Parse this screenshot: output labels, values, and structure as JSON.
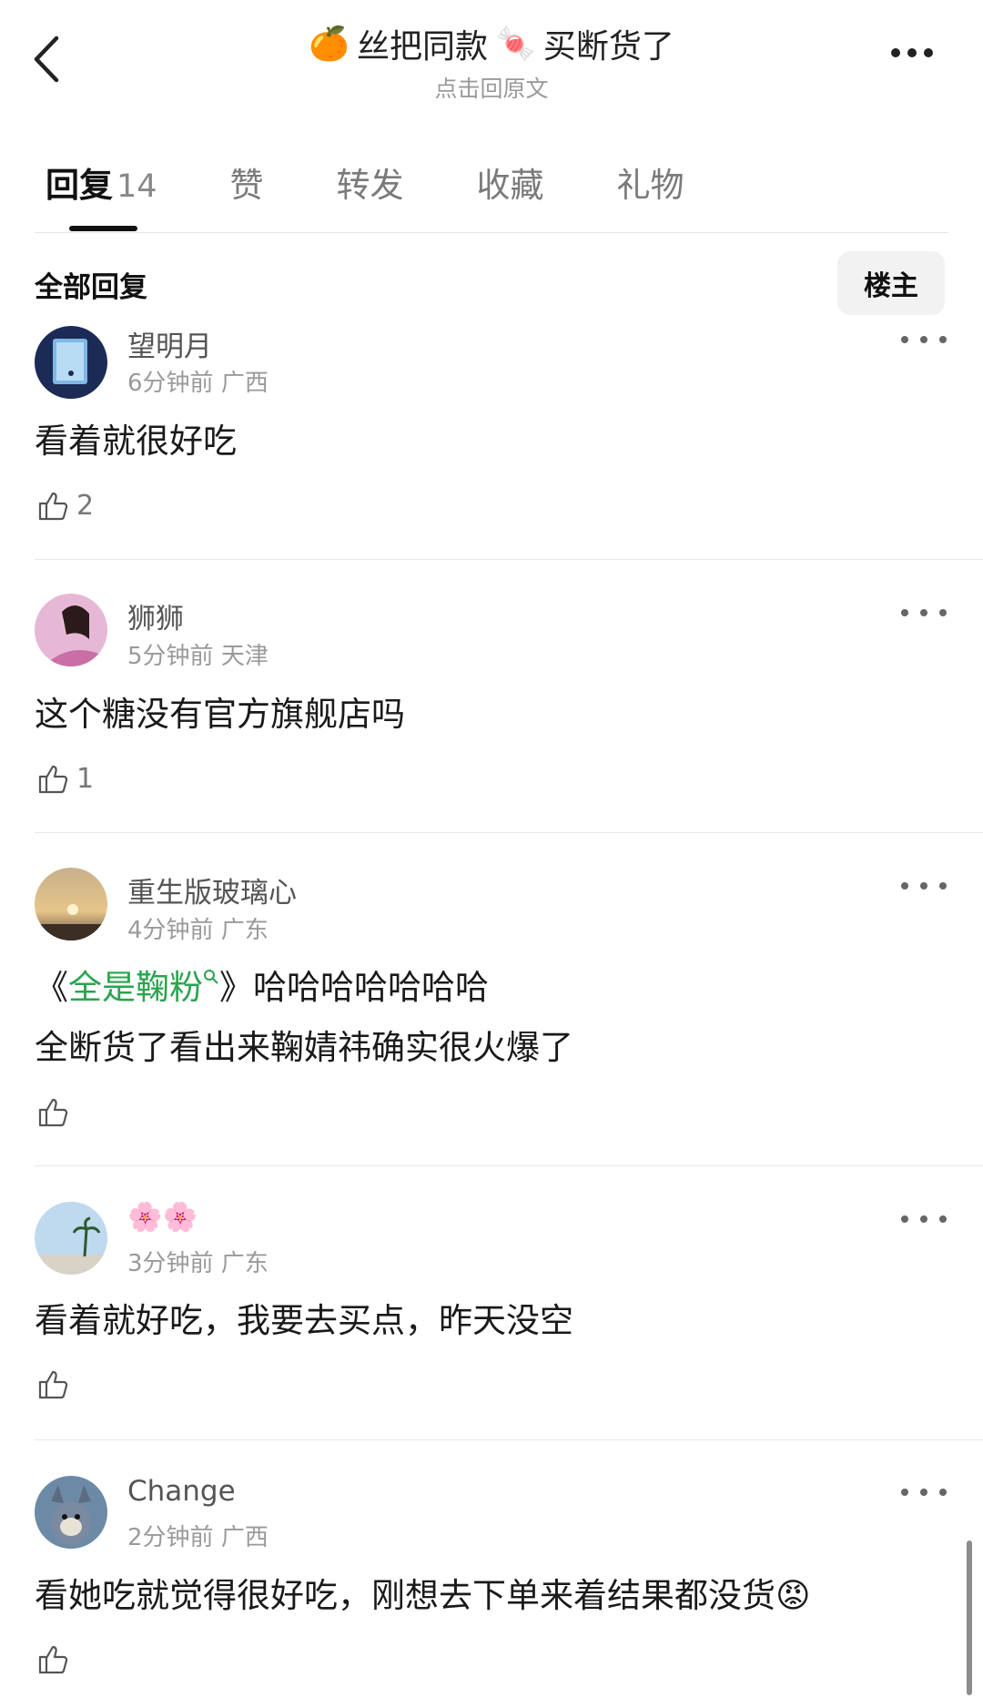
{
  "header": {
    "back_icon": "chevron-left-icon",
    "title_prefix_emoji": "🍊",
    "title_part1": "丝把同款",
    "title_mid_emoji": "🍬",
    "title_part2": "买断货了",
    "subtitle": "点击回原文",
    "more_icon": "ellipsis-icon"
  },
  "tabs": [
    {
      "label": "回复",
      "count": "14",
      "active": true
    },
    {
      "label": "赞"
    },
    {
      "label": "转发"
    },
    {
      "label": "收藏"
    },
    {
      "label": "礼物"
    }
  ],
  "section": {
    "title": "全部回复",
    "op_button": "楼主"
  },
  "comments": [
    {
      "user": "望明月",
      "time": "6分钟前",
      "location": "广西",
      "text": "看着就很好吃",
      "likes": "2"
    },
    {
      "user": "狮狮",
      "time": "5分钟前",
      "location": "天津",
      "text": "这个糖没有官方旗舰店吗",
      "likes": "1"
    },
    {
      "user": "重生版玻璃心",
      "time": "4分钟前",
      "location": "广东",
      "text_open": "《",
      "text_link": "全是鞠粉",
      "text_close": "》哈哈哈哈哈哈哈",
      "text_line2": "全断货了看出来鞠婧祎确实很火爆了",
      "likes": ""
    },
    {
      "user": "🌸🌸",
      "time": "3分钟前",
      "location": "广东",
      "text": "看着就好吃，我要去买点，昨天没空",
      "likes": ""
    },
    {
      "user": "Change",
      "time": "2分钟前",
      "location": "广西",
      "text": "看她吃就觉得很好吃，刚想去下单来着结果都没货",
      "text_emoji": "😡",
      "likes": ""
    }
  ],
  "colors": {
    "link": "#2aa44f",
    "meta": "#9a9a9a",
    "divider": "#e8e8e8"
  }
}
